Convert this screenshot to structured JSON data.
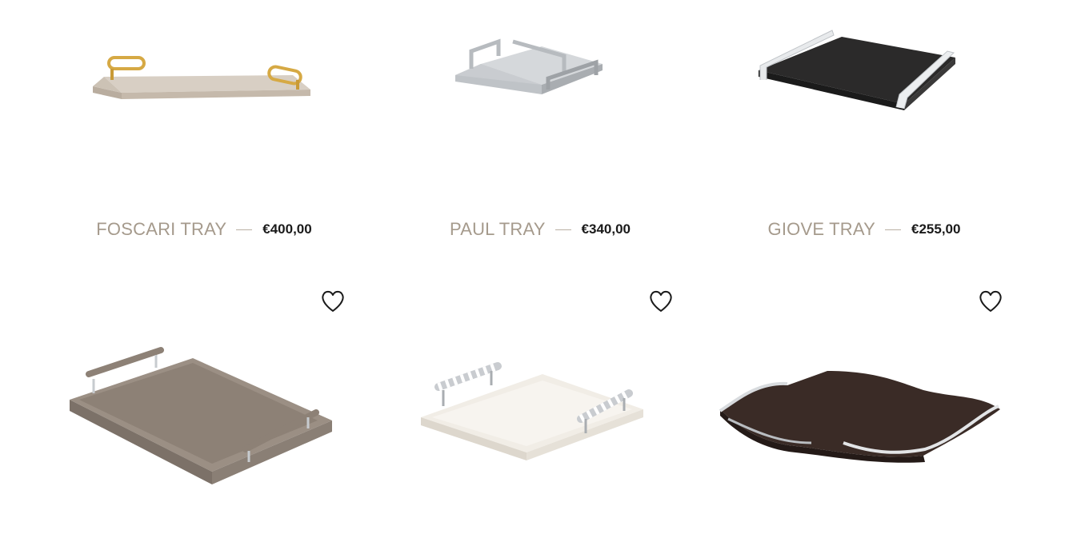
{
  "products": [
    {
      "name": "FOSCARI TRAY",
      "price": "€400,00",
      "icon": "foscari-tray-image"
    },
    {
      "name": "PAUL TRAY",
      "price": "€340,00",
      "icon": "paul-tray-image"
    },
    {
      "name": "GIOVE TRAY",
      "price": "€255,00",
      "icon": "giove-tray-image"
    }
  ],
  "second_row": [
    {
      "icon": "taupe-leather-tray-image",
      "wishlist_icon": "heart-icon"
    },
    {
      "icon": "ivory-leather-tray-image",
      "wishlist_icon": "heart-icon"
    },
    {
      "icon": "dark-wave-tray-image",
      "wishlist_icon": "heart-icon"
    }
  ]
}
